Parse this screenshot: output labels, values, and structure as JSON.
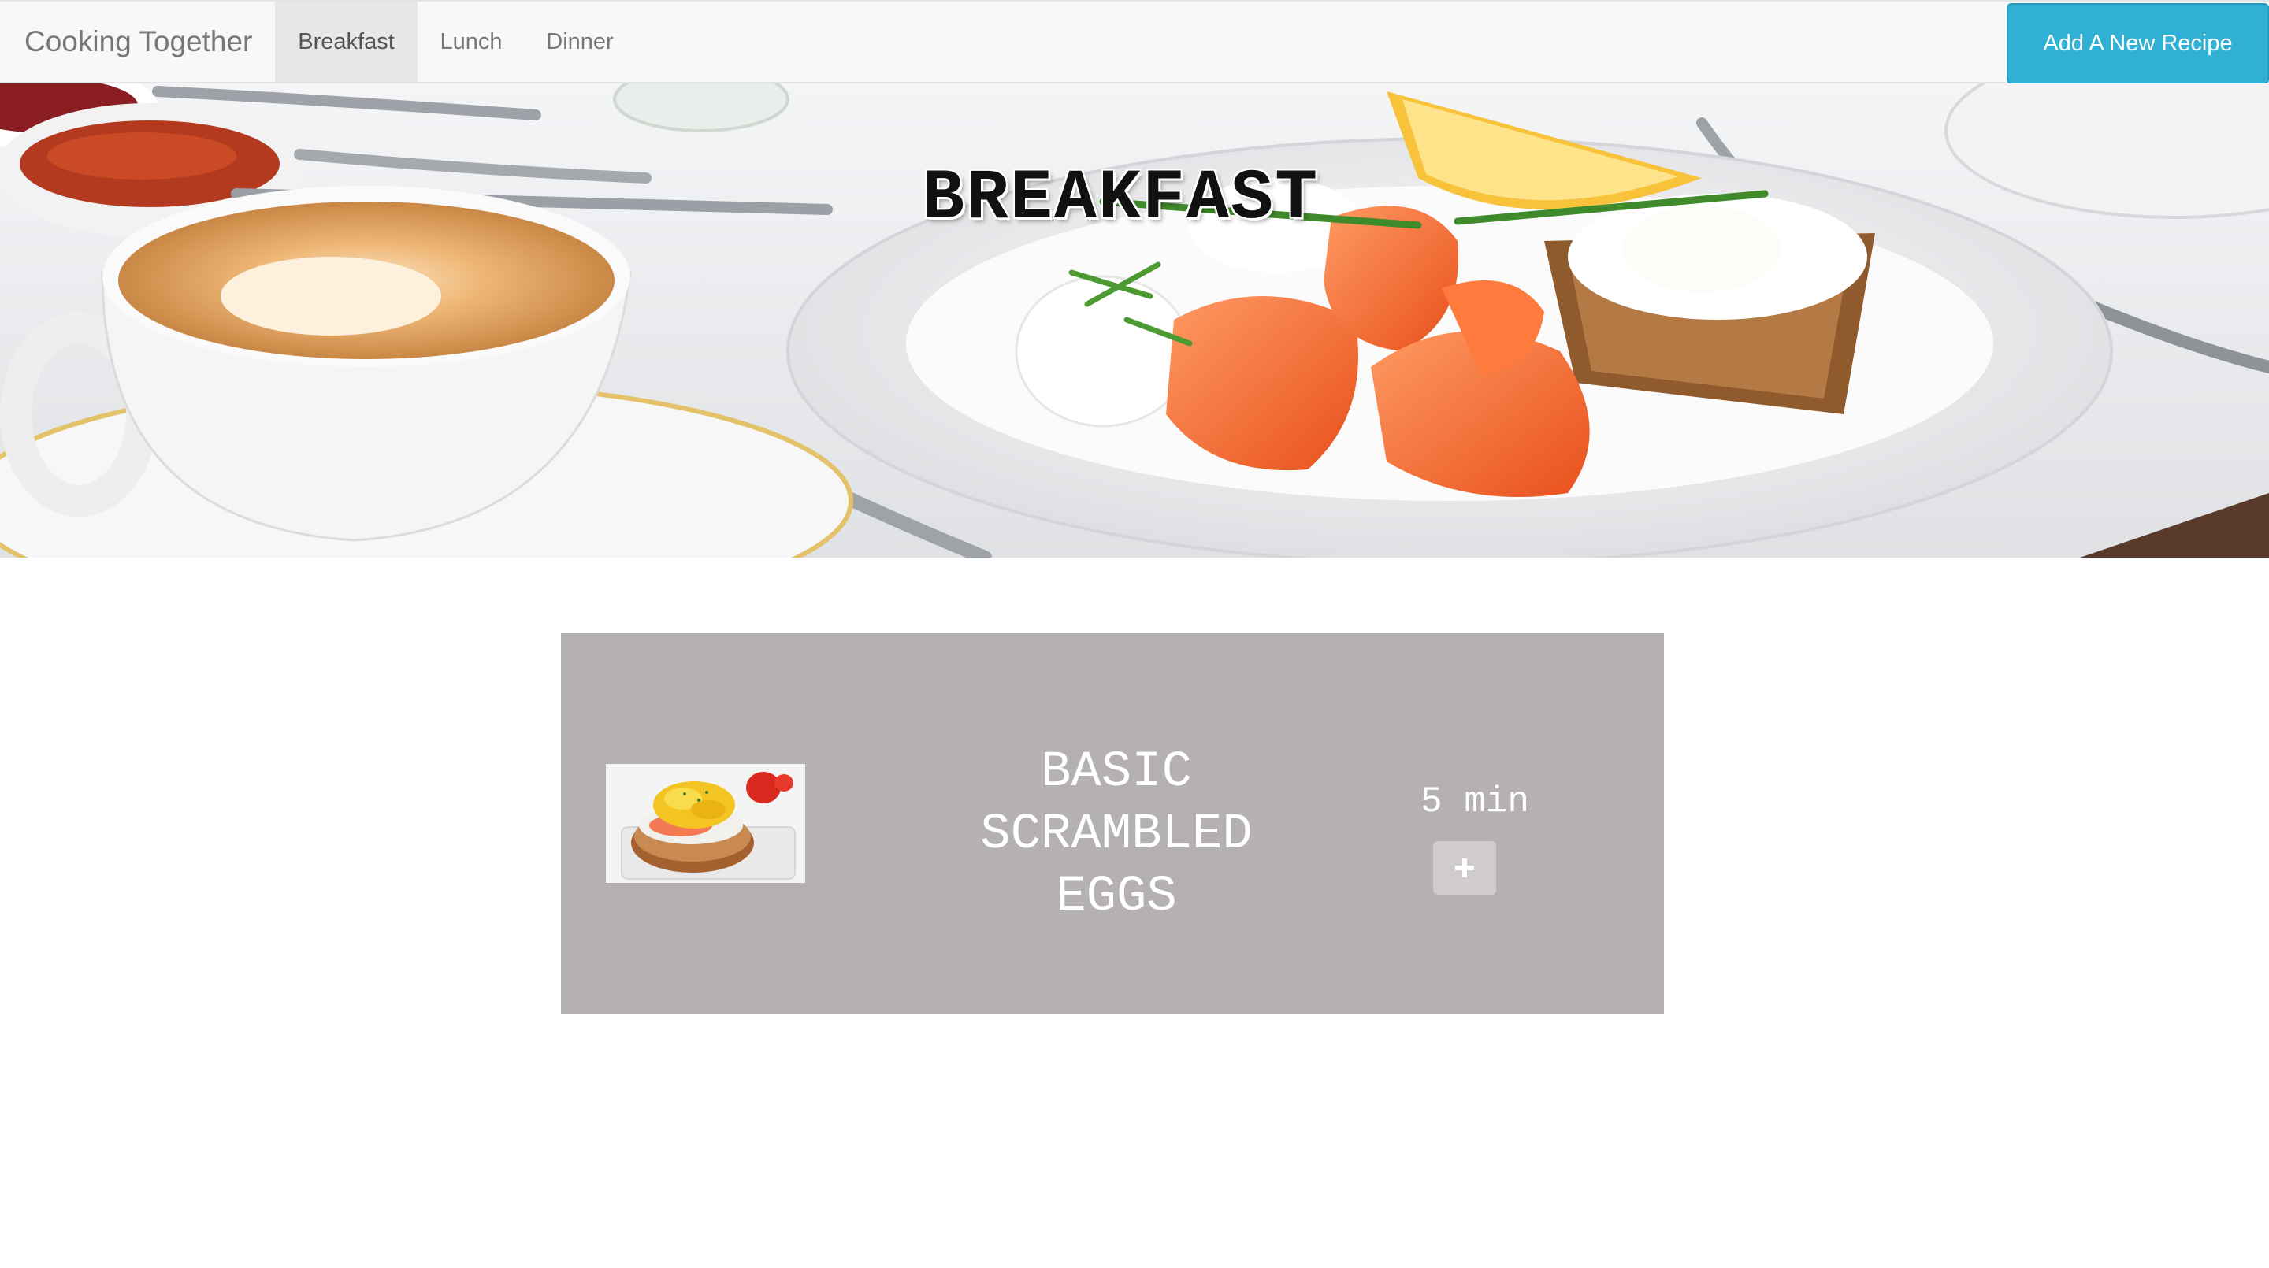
{
  "app": {
    "brand": "Cooking Together"
  },
  "nav": {
    "items": [
      {
        "label": "Breakfast",
        "active": true
      },
      {
        "label": "Lunch",
        "active": false
      },
      {
        "label": "Dinner",
        "active": false
      }
    ],
    "add_recipe_label": "Add A New Recipe"
  },
  "hero": {
    "title": "BREAKFAST",
    "image_icon": "breakfast-table-photo"
  },
  "recipes": [
    {
      "title_lines": [
        "BASIC",
        "SCRAMBLED",
        "EGGS"
      ],
      "time": "5 min",
      "image_icon": "scrambled-eggs-bagel-photo",
      "add_icon": "plus-icon"
    }
  ],
  "colors": {
    "navbar_bg": "#f8f8f8",
    "nav_active_bg": "#e7e7e7",
    "add_button_bg": "#31b0d5",
    "card_bg": "#b4b1b0"
  }
}
